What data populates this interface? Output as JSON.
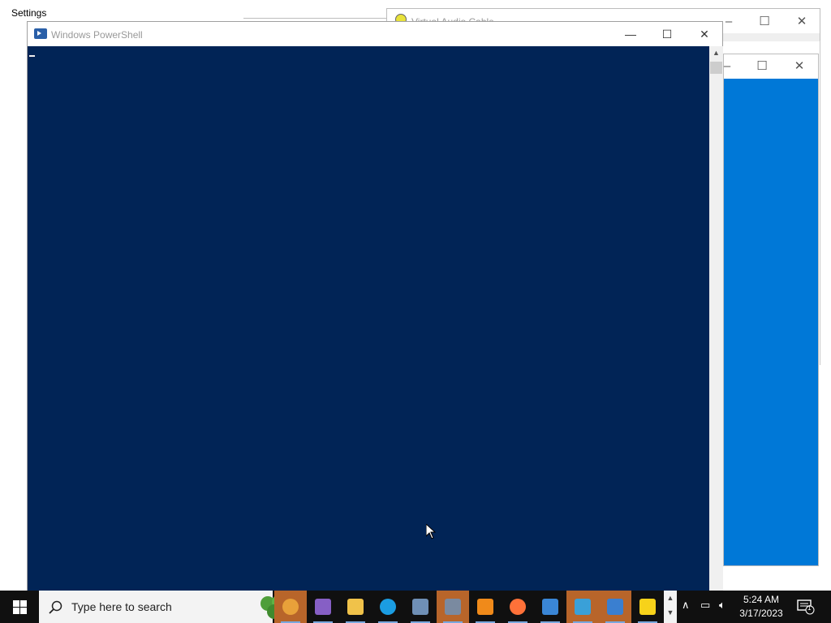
{
  "settings": {
    "title": "Settings"
  },
  "vac_window": {
    "title": "Virtual Audio Cable",
    "min": "–",
    "max": "☐",
    "close": "✕"
  },
  "blue_window": {
    "min": "–",
    "max": "☐",
    "close": "✕"
  },
  "powershell": {
    "title": "Windows PowerShell",
    "min": "—",
    "max": "☐",
    "close": "✕",
    "console_background": "#012456"
  },
  "taskbar": {
    "search_placeholder": "Type here to search",
    "apps": [
      {
        "name": "chrome",
        "color": "#e8a13a",
        "active": true
      },
      {
        "name": "visual-studio",
        "color": "#865fc5",
        "active": false
      },
      {
        "name": "file-explorer",
        "color": "#f0c24a",
        "active": false
      },
      {
        "name": "edge",
        "color": "#1b9de2",
        "active": false
      },
      {
        "name": "calculator",
        "color": "#6f8fb5",
        "active": false
      },
      {
        "name": "camera",
        "color": "#7a8aa0",
        "active": true
      },
      {
        "name": "search-tool",
        "color": "#f08a1a",
        "active": false
      },
      {
        "name": "firefox",
        "color": "#ff7139",
        "active": false
      },
      {
        "name": "store",
        "color": "#3a86d6",
        "active": false
      },
      {
        "name": "people",
        "color": "#3aa0d8",
        "active": true
      },
      {
        "name": "photos",
        "color": "#3a7fd0",
        "active": true
      },
      {
        "name": "sticky-notes",
        "color": "#f7d21a",
        "active": false
      }
    ],
    "clock_time": "5:24 AM",
    "clock_date": "3/17/2023",
    "notification_count": "1"
  }
}
